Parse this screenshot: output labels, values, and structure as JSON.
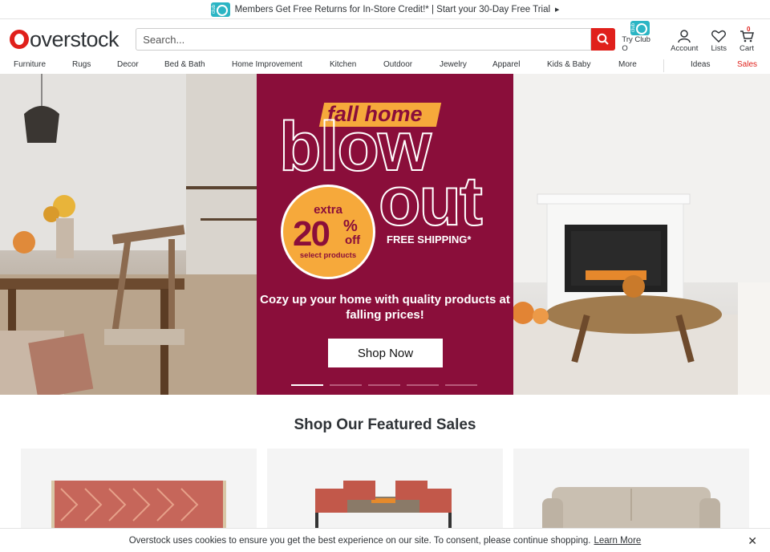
{
  "promo": {
    "text": "Members Get Free Returns for In-Store Credit!* | Start your 30-Day Free Trial",
    "club_label": "club"
  },
  "header": {
    "logo_text": "overstock",
    "search_placeholder": "Search...",
    "icons": [
      {
        "label": "Try Club O",
        "icon": "club-o-icon"
      },
      {
        "label": "Account",
        "icon": "user-icon"
      },
      {
        "label": "Lists",
        "icon": "heart-icon"
      },
      {
        "label": "Cart",
        "icon": "cart-icon",
        "count": "0"
      }
    ]
  },
  "nav": {
    "categories": [
      "Furniture",
      "Rugs",
      "Decor",
      "Bed & Bath",
      "Home Improvement",
      "Kitchen",
      "Outdoor",
      "Jewelry",
      "Apparel",
      "Kids & Baby",
      "More"
    ],
    "right": [
      "Ideas",
      "Sales"
    ]
  },
  "hero": {
    "tag": "fall home",
    "line1": "blow",
    "line2": "out",
    "badge_extra": "extra",
    "badge_pct": "20",
    "badge_sign": "%",
    "badge_off": "off",
    "badge_select": "select products",
    "free_shipping": "FREE SHIPPING*",
    "subtitle": "Cozy up your home with quality products at falling prices!",
    "cta": "Shop Now",
    "slides": 5,
    "active_slide": 1
  },
  "featured": {
    "title": "Shop Our Featured Sales"
  },
  "cookie": {
    "text": "Overstock uses cookies to ensure you get the best experience on our site. To consent, please continue shopping.",
    "link": "Learn More",
    "close": "✕"
  },
  "colors": {
    "brand_red": "#e0201b",
    "hero_maroon": "#8a0e3a",
    "accent_orange": "#f6a93b",
    "club_teal": "#2bb5c4"
  }
}
